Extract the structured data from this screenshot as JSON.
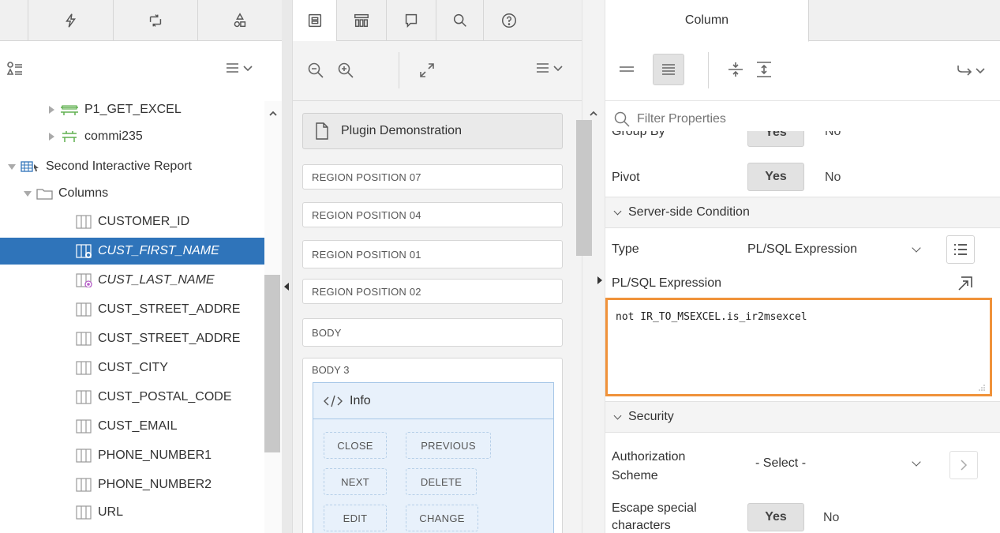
{
  "left": {
    "tree": [
      {
        "label": "P1_GET_EXCEL"
      },
      {
        "label": "commi235"
      },
      {
        "label": "Second Interactive Report"
      },
      {
        "label": "Columns"
      },
      {
        "label": "CUSTOMER_ID"
      },
      {
        "label": "CUST_FIRST_NAME"
      },
      {
        "label": "CUST_LAST_NAME"
      },
      {
        "label": "CUST_STREET_ADDRE"
      },
      {
        "label": "CUST_STREET_ADDRE"
      },
      {
        "label": "CUST_CITY"
      },
      {
        "label": "CUST_POSTAL_CODE"
      },
      {
        "label": "CUST_EMAIL"
      },
      {
        "label": "PHONE_NUMBER1"
      },
      {
        "label": "PHONE_NUMBER2"
      },
      {
        "label": "URL"
      }
    ]
  },
  "mid": {
    "plugin_label": "Plugin Demonstration",
    "regions": [
      "REGION POSITION 07",
      "REGION POSITION 04",
      "REGION POSITION 01",
      "REGION POSITION 02",
      "BODY"
    ],
    "body3_label": "BODY 3",
    "info_label": "Info",
    "buttons": [
      "CLOSE",
      "PREVIOUS",
      "NEXT",
      "DELETE",
      "EDIT",
      "CHANGE"
    ]
  },
  "right": {
    "tab_label": "Column",
    "filter_placeholder": "Filter Properties",
    "group_by": {
      "label": "Group By",
      "yes": "Yes",
      "no": "No"
    },
    "pivot": {
      "label": "Pivot",
      "yes": "Yes",
      "no": "No"
    },
    "server_side_section": "Server-side Condition",
    "type": {
      "label": "Type",
      "value": "PL/SQL Expression"
    },
    "plsql_label": "PL/SQL Expression",
    "plsql_code": "not IR_TO_MSEXCEL.is_ir2msexcel",
    "security_section": "Security",
    "auth": {
      "label": "Authorization Scheme",
      "value": "- Select -"
    },
    "escape": {
      "label": "Escape special characters",
      "yes": "Yes",
      "no": "No"
    }
  },
  "colors": {
    "selected": "#2f74ba",
    "highlight_border": "#f0923a",
    "info_bg": "#e8f1fb"
  }
}
